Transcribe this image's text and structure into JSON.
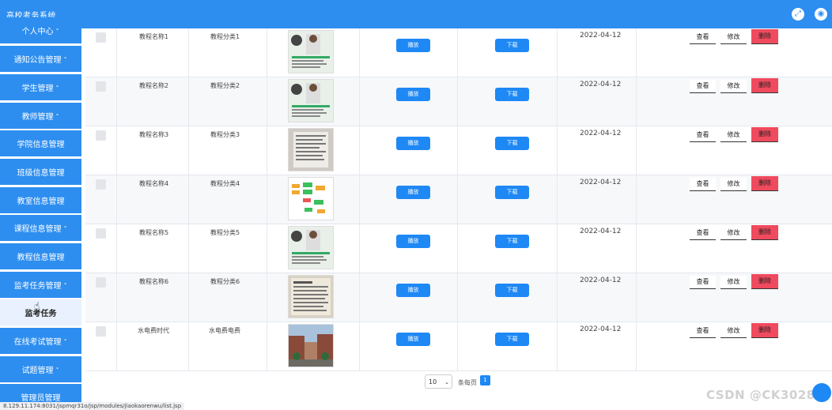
{
  "app": {
    "title": "高校考务系统"
  },
  "header": {
    "fullscreen_icon": "expand-icon",
    "user_icon": "user-icon"
  },
  "sidebar": {
    "items": [
      {
        "label": "个人中心",
        "chev": "⌄"
      },
      {
        "label": "通知公告管理",
        "chev": "⌄"
      },
      {
        "label": "学生管理",
        "chev": "⌄"
      },
      {
        "label": "教师管理",
        "chev": "⌄"
      },
      {
        "label": "学院信息管理",
        "chev": ""
      },
      {
        "label": "班级信息管理",
        "chev": ""
      },
      {
        "label": "教室信息管理",
        "chev": ""
      },
      {
        "label": "课程信息管理",
        "chev": "⌄"
      },
      {
        "label": "教程信息管理",
        "chev": ""
      },
      {
        "label": "监考任务管理",
        "chev": "⌄"
      },
      {
        "label": "监考任务",
        "chev": ""
      },
      {
        "label": "在线考试管理",
        "chev": "⌄"
      },
      {
        "label": "试题管理",
        "chev": "⌄"
      },
      {
        "label": "管理员管理",
        "chev": ""
      }
    ]
  },
  "table": {
    "rows": [
      {
        "name": "教程名称1",
        "category": "教程分类1",
        "play": "播放",
        "download": "下载",
        "date": "2022-04-12",
        "view": "查看",
        "edit": "修改",
        "delete": "删除"
      },
      {
        "name": "教程名称2",
        "category": "教程分类2",
        "play": "播放",
        "download": "下载",
        "date": "2022-04-12",
        "view": "查看",
        "edit": "修改",
        "delete": "删除"
      },
      {
        "name": "教程名称3",
        "category": "教程分类3",
        "play": "播放",
        "download": "下载",
        "date": "2022-04-12",
        "view": "查看",
        "edit": "修改",
        "delete": "删除"
      },
      {
        "name": "教程名称4",
        "category": "教程分类4",
        "play": "播放",
        "download": "下载",
        "date": "2022-04-12",
        "view": "查看",
        "edit": "修改",
        "delete": "删除"
      },
      {
        "name": "教程名称5",
        "category": "教程分类5",
        "play": "播放",
        "download": "下载",
        "date": "2022-04-12",
        "view": "查看",
        "edit": "修改",
        "delete": "删除"
      },
      {
        "name": "教程名称6",
        "category": "教程分类6",
        "play": "播放",
        "download": "下载",
        "date": "2022-04-12",
        "view": "查看",
        "edit": "修改",
        "delete": "删除"
      },
      {
        "name": "水电费时代",
        "category": "水电费电费",
        "play": "播放",
        "download": "下载",
        "date": "2022-04-12",
        "view": "查看",
        "edit": "修改",
        "delete": "删除"
      }
    ]
  },
  "pagination": {
    "page_size": "10",
    "per_page_label": "条每页",
    "current_page": "1"
  },
  "status_url": "8.129.11.174:8031/jspmqr31o/jsp/modules/jiaokaorenwu/list.jsp",
  "watermark": "CSDN @CK3028"
}
